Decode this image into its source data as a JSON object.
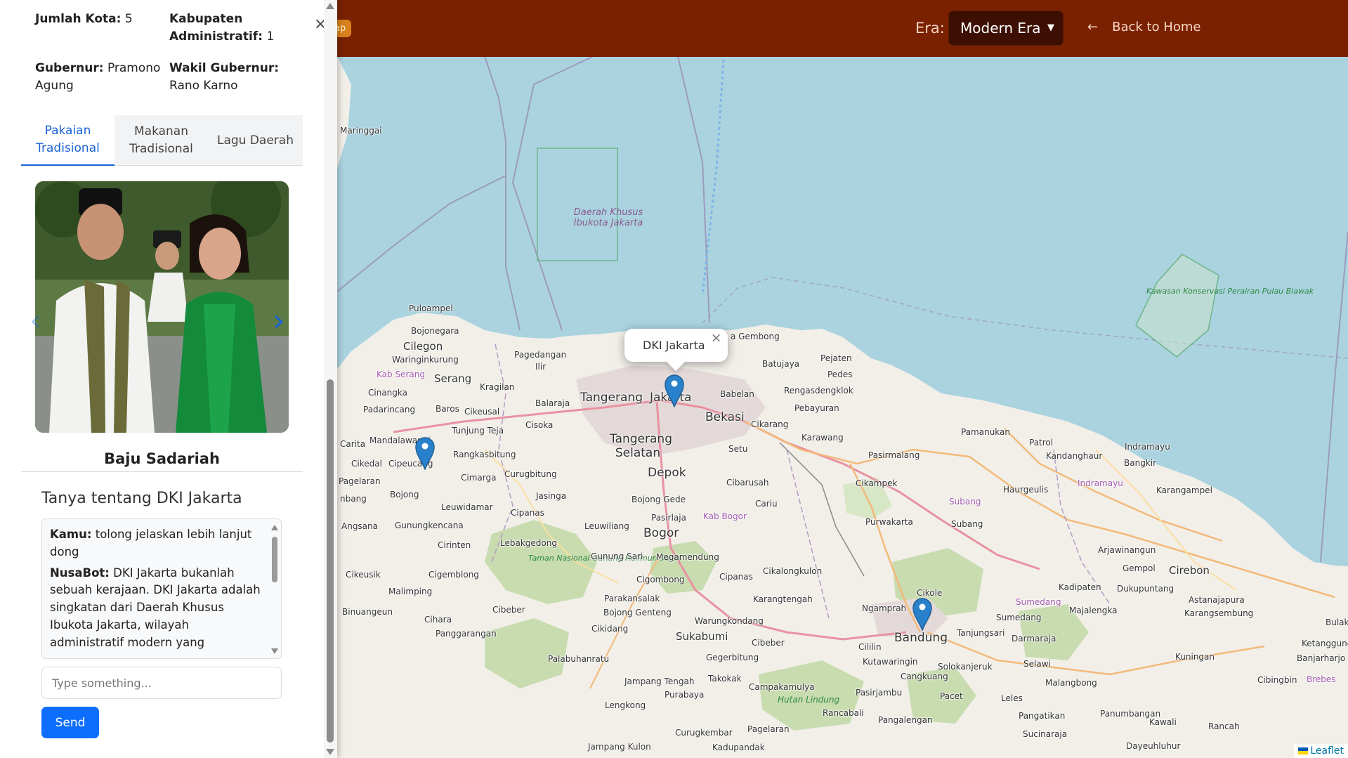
{
  "header": {
    "chip_label": "ap",
    "era_label": "Era:",
    "era_selected": "Modern Era",
    "back_label": "Back to Home"
  },
  "colors": {
    "header_bg": "#7a2102",
    "accent_blue": "#0d6efd",
    "water": "#aad3df",
    "land": "#f2efe9"
  },
  "sidebar": {
    "close_icon": "×",
    "info": [
      {
        "label": "Jumlah Kota:",
        "value": "5"
      },
      {
        "label": "Kabupaten Administratif:",
        "value": "1"
      },
      {
        "label": "Gubernur:",
        "value": "Pramono Agung"
      },
      {
        "label": "Wakil Gubernur:",
        "value": "Rano Karno"
      }
    ],
    "tabs": [
      {
        "label": "Pakaian Tradisional",
        "active": true
      },
      {
        "label": "Makanan Tradisional",
        "active": false
      },
      {
        "label": "Lagu Daerah",
        "active": false
      }
    ],
    "carousel": {
      "prev_icon": "‹",
      "next_icon": "›",
      "caption": "Baju Sadariah"
    },
    "chat": {
      "title": "Tanya tentang DKI Jakarta",
      "messages": [
        {
          "speaker": "Kamu:",
          "text": "tolong jelaskan lebih lanjut dong"
        },
        {
          "speaker": "NusaBot:",
          "text": "DKI Jakarta bukanlah sebuah kerajaan. DKI Jakarta adalah singkatan dari Daerah Khusus Ibukota Jakarta, wilayah administratif modern yang"
        }
      ],
      "input_placeholder": "Type something...",
      "send_label": "Send"
    }
  },
  "map": {
    "popup_text": "DKI Jakarta",
    "popup_close": "×",
    "attribution": "Leaflet",
    "labels": {
      "maringgai": "Maringgai",
      "dki_zone": "Daerah Khusus Ibukota Jakarta",
      "kawasan": "Kawasan Konservasi Perairan Pulau Biawak",
      "puloampel": "Puloampel",
      "bojonegara": "Bojonegara",
      "cilegon": "Cilegon",
      "waringinkurung": "Waringinkurung",
      "kab_serang": "Kab Serang",
      "serang": "Serang",
      "cinangka": "Cinangka",
      "padarincang": "Padarincang",
      "carita": "Carita",
      "mandalawangi": "Mandalawangi",
      "cikedal": "Cikedal",
      "cipeucang": "Cipeucang",
      "pagelaran": "Pagelaran",
      "angsana": "Angsana",
      "nbang": "nbang",
      "cikeusik": "Cikeusik",
      "binuangeun": "Binuangeun",
      "baros": "Baros",
      "cikeusal": "Cikeusal",
      "kragilan": "Kragilan",
      "pagedangan": "Pagedangan",
      "ilir": "Ilir",
      "tunjung_teja": "Tunjung Teja",
      "cisoka": "Cisoka",
      "balaraja": "Balaraja",
      "tangerang": "Tangerang",
      "jakarta": "Jakarta",
      "tangerang_selatan": "Tangerang Selatan",
      "rangkasbitung": "Rangkasbitung",
      "cimarga": "Cimarga",
      "curugbitung": "Curugbitung",
      "bojong": "Bojong",
      "leuwidamar": "Leuwidamar",
      "gunungkencana": "Gunungkencana",
      "cipanas_w": "Cipanas",
      "jasinga": "Jasinga",
      "cirinten": "Cirinten",
      "cigemblong": "Cigemblong",
      "malimping": "Malimping",
      "cihara": "Cihara",
      "panggarangan": "Panggarangan",
      "cibeber_w": "Cibeber",
      "lebakgedong": "Lebakgedong",
      "taman_nasional": "Taman Nasional Gunung Halimun Salak",
      "leuwiliang": "Leuwiliang",
      "gunung_sari": "Gunung Sari",
      "parakansalak": "Parakansalak",
      "bojong_genteng": "Bojong Genteng",
      "cikidang": "Cikidang",
      "palabuhanratu": "Palabuhanratu",
      "jampang_tengah": "Jampang Tengah",
      "purabaya": "Purabaya",
      "lengkong": "Lengkong",
      "jampang_kulon": "Jampang Kulon",
      "gembong": "a Gembong",
      "batujaya": "Batujaya",
      "pejaten": "Pejaten",
      "pedes": "Pedes",
      "babelan": "Babelan",
      "bekasi": "Bekasi",
      "rengasdengklok": "Rengasdengklok",
      "pebayuran": "Pebayuran",
      "cikarang": "Cikarang",
      "karawang": "Karawang",
      "setu": "Setu",
      "depok": "Depok",
      "bojong_gede": "Bojong Gede",
      "pasirlaja": "Pasirlaja",
      "cibarusah": "Cibarusah",
      "cariu": "Cariu",
      "kab_bogor": "Kab Bogor",
      "bogor": "Bogor",
      "megamendung": "Megamendung",
      "cipanas_e": "Cipanas",
      "cigombong": "Cigombong",
      "cikalongkulon": "Cikalongkulon",
      "karangtengah": "Karangtengah",
      "warungkondang": "Warungkondang",
      "sukabumi": "Sukabumi",
      "cibeber_e": "Cibeber",
      "gegerbitung": "Gegerbitung",
      "takokak": "Takokak",
      "campakamulya": "Campakamulya",
      "hutan_lindung": "Hutan Lindung",
      "rancabali": "Rancabali",
      "curugkembar": "Curugkembar",
      "pagelaran_e": "Pagelaran",
      "kadupandak": "Kadupandak",
      "pamanukan": "Pamanukan",
      "pasirmalang": "Pasirmalang",
      "cikampek": "Cikampek",
      "subang_admin": "Subang",
      "subang": "Subang",
      "purwakarta": "Purwakarta",
      "haurgeulis": "Haurgeulis",
      "indramayu_admin": "Indramayu",
      "indramayu": "Indramayu",
      "bangkir": "Bangkir",
      "patrol": "Patrol",
      "kandanghaur": "Kandanghaur",
      "karangampel": "Karangampel",
      "arjawinangun": "Arjawinangun",
      "gempol": "Gempol",
      "cirebon": "Cirebon",
      "kadipaten": "Kadipaten",
      "dukupuntang": "Dukupuntang",
      "astanajapura": "Astanajapura",
      "karangsembung": "Karangsembung",
      "bulak": "Bulak",
      "ketanggung": "Ketanggung",
      "banjarharjo": "Banjarharjo",
      "kuningan": "Kuningan",
      "cibingbin": "Cibingbin",
      "brebes": "Brebes",
      "majalengka": "Majalengka",
      "sumedang_admin": "Sumedang",
      "sumedang": "Sumedang",
      "darmaraja": "Darmaraja",
      "tanjungsari": "Tanjungsari",
      "cikole": "Cikole",
      "ngamprah": "Ngamprah",
      "cililin": "Cililin",
      "bandung": "Bandung",
      "kutawaringin": "Kutawaringin",
      "cangkuang": "Cangkuang",
      "solokanjeruk": "Solokanjeruk",
      "selawi": "Selawi",
      "malangbong": "Malangbong",
      "pasirjambu": "Pasirjambu",
      "pangalengan": "Pangalengan",
      "pacet": "Pacet",
      "leles": "Leles",
      "pangatikan": "Pangatikan",
      "panumbangan": "Panumbangan",
      "kawali": "Kawali",
      "rancah": "Rancah",
      "sucinaraja": "Sucinaraja",
      "dayeuhluhur": "Dayeuhluhur"
    }
  }
}
